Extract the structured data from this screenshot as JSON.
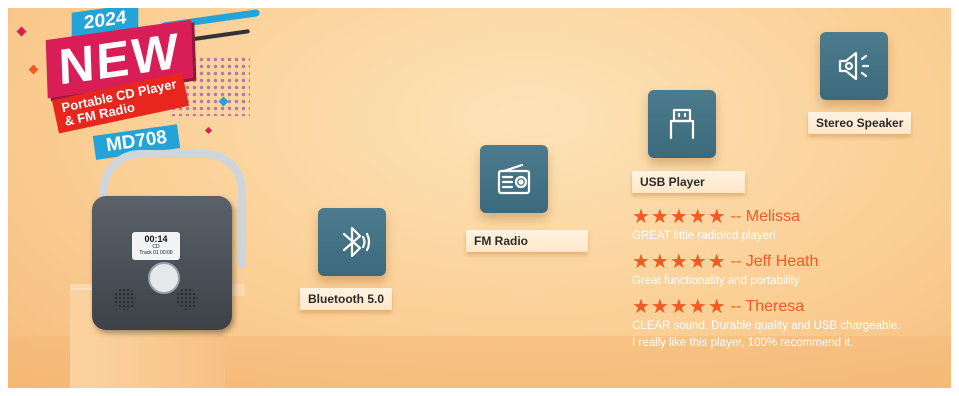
{
  "badge": {
    "year": "2024",
    "headline": "NEW",
    "subtitle_line1": "Portable CD Player",
    "subtitle_line2": "& FM Radio",
    "model": "MD708"
  },
  "device": {
    "screen_time": "00:14",
    "screen_sub": "CD",
    "screen_track": "Track 01 00:00"
  },
  "features": [
    {
      "label": "Bluetooth 5.0",
      "icon": "bluetooth-icon"
    },
    {
      "label": "FM Radio",
      "icon": "radio-icon"
    },
    {
      "label": "USB Player",
      "icon": "usb-icon"
    },
    {
      "label": "Stereo Speaker",
      "icon": "speaker-icon"
    }
  ],
  "reviews": [
    {
      "stars": "★★★★★",
      "name": "-- Melissa",
      "rating": 5,
      "text": "GREAT little radio/cd player!"
    },
    {
      "stars": "★★★★★",
      "name": "-- Jeff Heath",
      "rating": 5,
      "text": "Great functionality and portability"
    },
    {
      "stars": "★★★★★",
      "name": "-- Theresa",
      "rating": 5,
      "text": "CLEAR sound. Durable quality and USB chargeable.",
      "text2": "I really like this player, 100% recommend it."
    }
  ],
  "colors": {
    "accent": "#f15a22",
    "tile": "#3f6f80",
    "background": "#fbcf95"
  }
}
